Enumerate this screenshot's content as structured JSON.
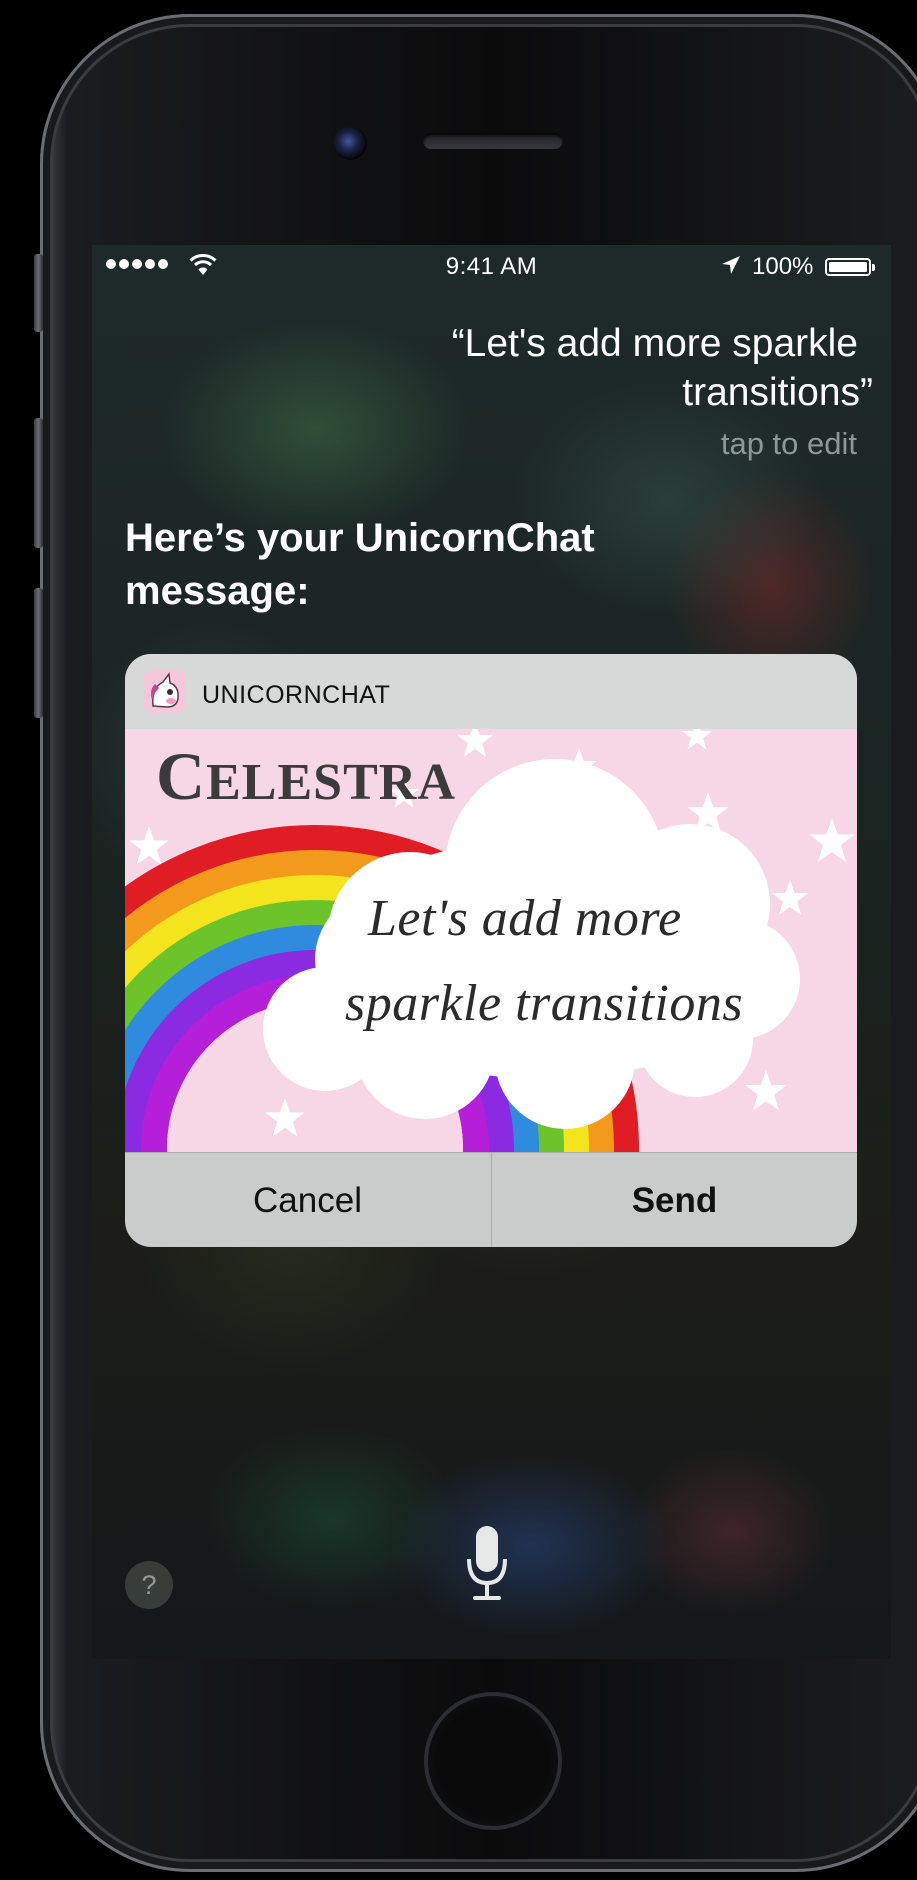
{
  "status_bar": {
    "time": "9:41 AM",
    "battery_percent": "100%",
    "signal_bars": 5,
    "icons": [
      "signal-dots-icon",
      "wifi-icon",
      "location-arrow-icon",
      "battery-icon"
    ]
  },
  "siri": {
    "query_line1": "“Let's add more sparkle",
    "query_line2": "transitions”",
    "tap_to_edit": "tap to edit",
    "response_line1": "Here’s your UnicornChat",
    "response_line2": "message:"
  },
  "card": {
    "app_name": "UNICORNCHAT",
    "app_icon": "unicorn-icon",
    "image": {
      "title_initial": "C",
      "title_rest": "ELESTRA",
      "message_line1": "Let's add more",
      "message_line2": "sparkle transitions"
    },
    "cancel_label": "Cancel",
    "send_label": "Send"
  },
  "bottom": {
    "help_label": "?",
    "mic_icon": "microphone-icon"
  },
  "colors": {
    "card_background": "#c9cccb",
    "card_header": "#d6d9d8",
    "image_background": "#f7d6e5",
    "tap_to_edit": "#8e989a",
    "rainbow": [
      "#e01c24",
      "#f39a1c",
      "#f3e41d",
      "#6cc42a",
      "#2f8bde",
      "#8a2be2",
      "#b51fd9"
    ]
  }
}
